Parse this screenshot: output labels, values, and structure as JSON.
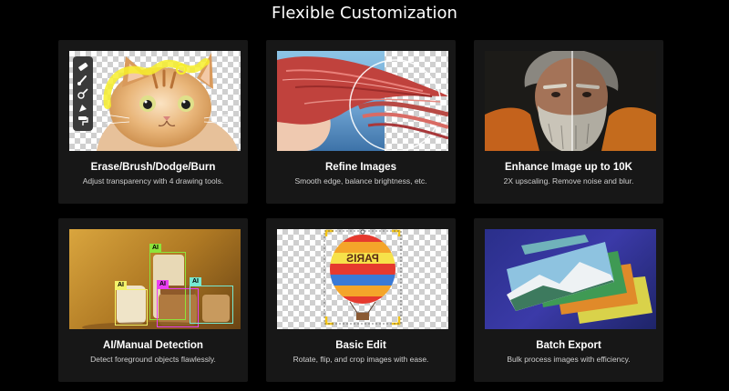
{
  "page": {
    "title": "Flexible Customization"
  },
  "colors": {
    "background": "#000000",
    "card": "#171717",
    "ai_green": "#8de43b",
    "ai_yellow": "#f3f36b",
    "ai_magenta": "#ea3ef2",
    "ai_teal": "#77e9d2",
    "brush_yellow": "#f7ee2c"
  },
  "cards": [
    {
      "title": "Erase/Brush/Dodge/Burn",
      "description": "Adjust transparency with 4 drawing tools."
    },
    {
      "title": "Refine Images",
      "description": "Smooth edge, balance brightness, etc."
    },
    {
      "title": "Enhance Image up to 10K",
      "description": "2X upscaling. Remove noise and blur."
    },
    {
      "title": "AI/Manual Detection",
      "description": "Detect foreground objects flawlessly."
    },
    {
      "title": "Basic Edit",
      "description": "Rotate, flip, and crop images with ease."
    },
    {
      "title": "Batch Export",
      "description": "Bulk process images with efficiency."
    }
  ],
  "tools": [
    "eraser-icon",
    "brush-icon",
    "dodge-icon",
    "burn-icon",
    "paint-roller-icon"
  ],
  "detection": {
    "tag_labels": [
      "AI",
      "AI",
      "AI",
      "AI"
    ]
  },
  "balloon": {
    "text": "PARIS"
  }
}
